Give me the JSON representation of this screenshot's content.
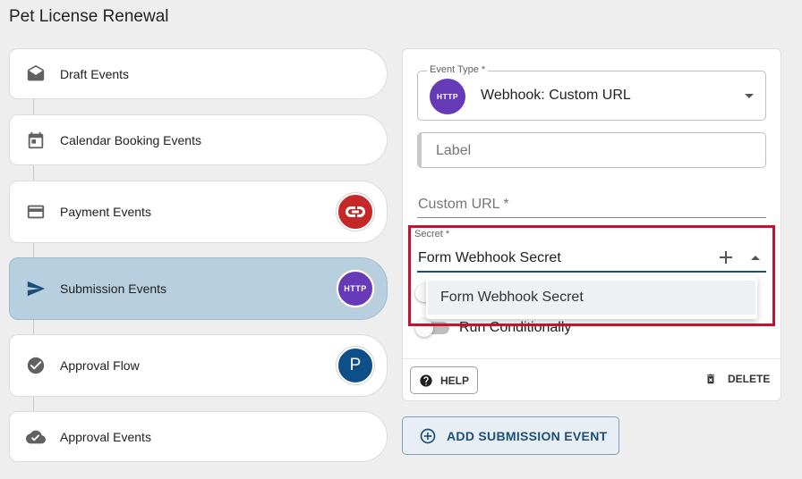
{
  "page": {
    "title": "Pet License Renewal"
  },
  "events": [
    {
      "label": "Draft Events",
      "icon": "envelope-open-icon"
    },
    {
      "label": "Calendar Booking Events",
      "icon": "calendar-icon"
    },
    {
      "label": "Payment Events",
      "icon": "credit-card-icon",
      "badge": "payment-link-icon"
    },
    {
      "label": "Submission Events",
      "icon": "send-icon",
      "badge_text": "HTTP",
      "active": true
    },
    {
      "label": "Approval Flow",
      "icon": "check-circle-icon",
      "badge_text": "P"
    },
    {
      "label": "Approval Events",
      "icon": "cloud-check-icon"
    }
  ],
  "form": {
    "event_type": {
      "label": "Event Type *",
      "badge_text": "HTTP",
      "value": "Webhook: Custom URL"
    },
    "label_field": {
      "placeholder": "Label"
    },
    "custom_url": {
      "placeholder": "Custom URL *"
    },
    "secret": {
      "label": "Secret *",
      "value": "Form Webhook Secret",
      "options": [
        "Form Webhook Secret"
      ]
    },
    "run_conditionally": {
      "label": "Run Conditionally",
      "checked": false
    }
  },
  "actions": {
    "help": "HELP",
    "delete": "DELETE",
    "add_event": "ADD SUBMISSION EVENT"
  },
  "colors": {
    "accent": "#673ab7",
    "primary": "#1b4f7a",
    "highlight": "#c4122f",
    "active_item": "#b8cfe0"
  }
}
